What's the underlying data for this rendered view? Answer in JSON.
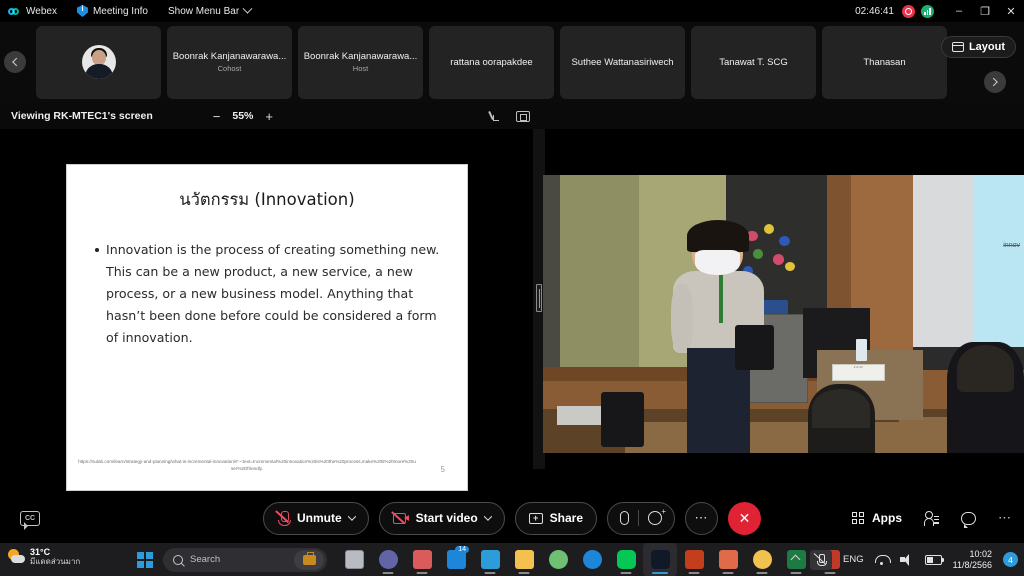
{
  "titlebar": {
    "app_name": "Webex",
    "meeting_info": "Meeting Info",
    "show_menu_bar": "Show Menu Bar",
    "timer": "02:46:41",
    "minimize": "–",
    "maximize": "❐",
    "close": "✕"
  },
  "participants": {
    "tiles": [
      {
        "name": "",
        "role": "",
        "has_avatar": true
      },
      {
        "name": "Boonrak Kanjanawarawa...",
        "role": "Cohost",
        "has_avatar": false
      },
      {
        "name": "Boonrak Kanjanawarawa...",
        "role": "Host",
        "has_avatar": false
      },
      {
        "name": "rattana oorapakdee",
        "role": "",
        "has_avatar": false
      },
      {
        "name": "Suthee Wattanasiriwech",
        "role": "",
        "has_avatar": false
      },
      {
        "name": "Tanawat T. SCG",
        "role": "",
        "has_avatar": false
      },
      {
        "name": "Thanasan",
        "role": "",
        "has_avatar": false
      }
    ],
    "layout_label": "Layout"
  },
  "viewbar": {
    "viewing_text": "Viewing RK-MTEC1's screen",
    "zoom_out": "−",
    "zoom_level": "55%",
    "zoom_in": "+"
  },
  "slide": {
    "title": "นวัตกรรม (Innovation)",
    "bullet": "Innovation is the process of creating something new. This can be a new product, a new service, a new process, or a new business model. Anything that hasn’t been done before could be considered a form of innovation.",
    "footer_url": "https://nulab.com/learn/strategy-and-planning/what-is-incremental-innovation/#:~:text=Incremental%20innovation%20is%20the%20process,make%20it%20more%20user%2Dfriendly.",
    "page_number": "5"
  },
  "video": {
    "projected_text": "innov",
    "nameplate": "อาจารย์"
  },
  "controls": {
    "cc_label": "CC",
    "unmute": "Unmute",
    "start_video": "Start video",
    "share": "Share",
    "more": "⋯",
    "end_call": "✕",
    "apps": "Apps",
    "right_more": "⋯"
  },
  "taskbar": {
    "weather_temp": "31°C",
    "weather_desc": "มีแดดส่วนมาก",
    "search_placeholder": "Search",
    "apps": [
      {
        "name": "task-view",
        "color": "#b8bcc2"
      },
      {
        "name": "teams",
        "color": "#6264a7"
      },
      {
        "name": "snipping-tool",
        "color": "#d95b5b"
      },
      {
        "name": "mail",
        "color": "#1e86d8",
        "badge": "14"
      },
      {
        "name": "calendar",
        "color": "#2d9cdb"
      },
      {
        "name": "file-explorer",
        "color": "#f2c14e"
      },
      {
        "name": "world-clock",
        "color": "#6fbf73"
      },
      {
        "name": "edge",
        "color": "#1e86d8"
      },
      {
        "name": "line",
        "color": "#06c755"
      },
      {
        "name": "webex",
        "color": "#111827",
        "active": true
      },
      {
        "name": "powerpoint",
        "color": "#c43e1c"
      },
      {
        "name": "powerpoint-2",
        "color": "#e06a4a"
      },
      {
        "name": "chrome",
        "color": "#f2c14e"
      },
      {
        "name": "excel",
        "color": "#1d7a42"
      },
      {
        "name": "acrobat",
        "color": "#c0392b"
      }
    ],
    "language": "ENG",
    "time": "10:02",
    "date": "11/8/2566",
    "notification_count": "4"
  }
}
